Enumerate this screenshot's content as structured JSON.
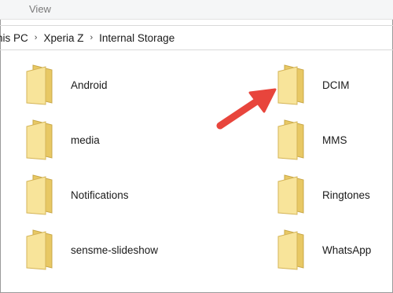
{
  "menubar": {
    "view_label": "View"
  },
  "address": {
    "crumbs": [
      "his PC",
      "Xperia Z",
      "Internal Storage"
    ]
  },
  "folders": [
    {
      "name": "Android"
    },
    {
      "name": "DCIM"
    },
    {
      "name": "media"
    },
    {
      "name": "MMS"
    },
    {
      "name": "Notifications"
    },
    {
      "name": "Ringtones"
    },
    {
      "name": "sensme-slideshow"
    },
    {
      "name": "WhatsApp"
    }
  ],
  "icons": {
    "folder": "folder-icon",
    "separator": "chevron-right-icon",
    "annotation": "red-arrow-icon"
  },
  "colors": {
    "folder_front": "#f8e49a",
    "folder_back": "#e8c864",
    "arrow": "#e8453c"
  }
}
